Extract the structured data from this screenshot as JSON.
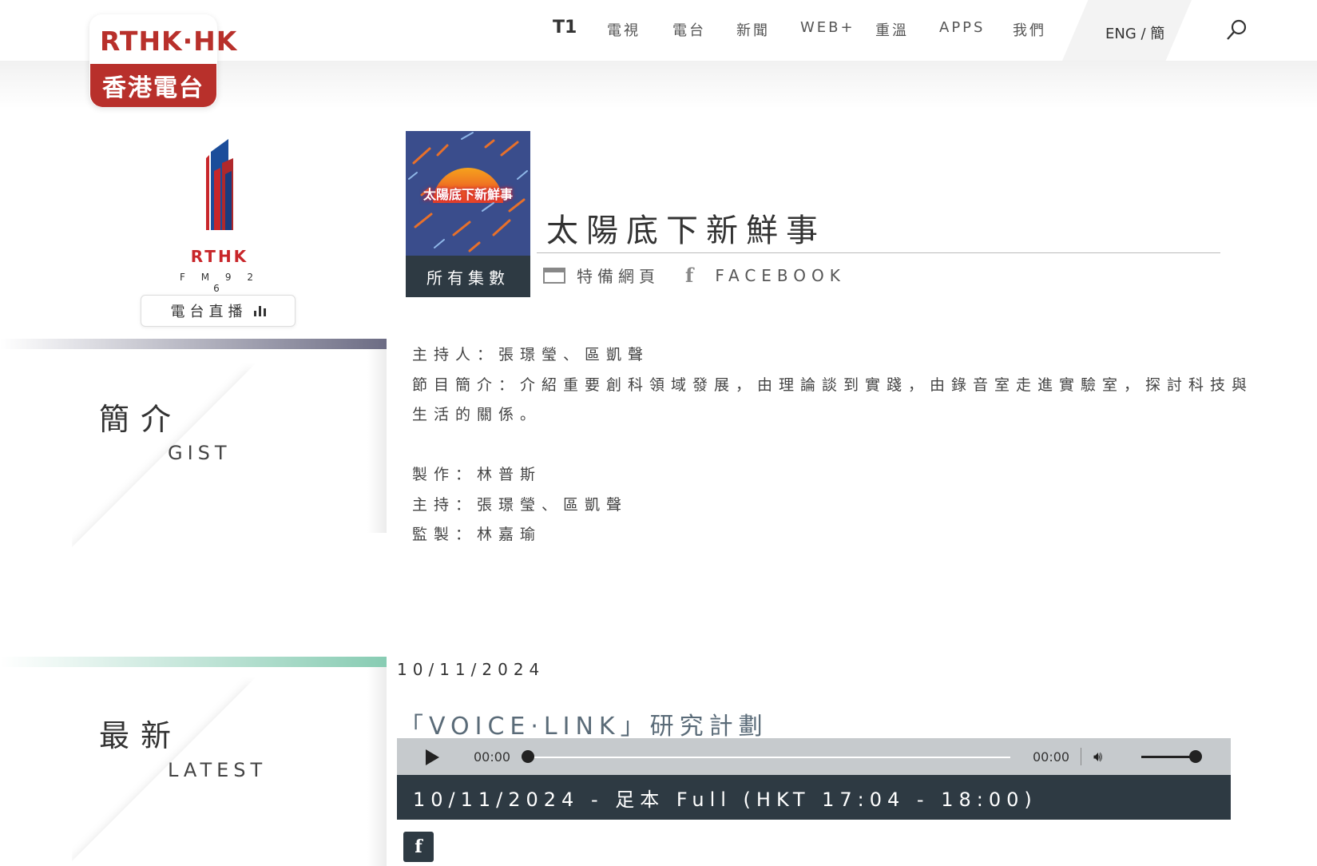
{
  "brand": {
    "logo_top": "RTHK·HK",
    "logo_bottom": "香港電台"
  },
  "nav": {
    "items": [
      "T1",
      "電視",
      "電台",
      "新聞",
      "WEB+",
      "重溫",
      "APPS",
      "我們"
    ],
    "language": "ENG / 簡"
  },
  "station": {
    "name": "RTHK",
    "frequency": "F M 9 2 6",
    "live_label": "電台直播"
  },
  "program": {
    "thumbnail_text": "太陽底下新鮮事",
    "title": "太陽底下新鮮事",
    "all_episodes_label": "所有集數",
    "special_page_label": "特備網頁",
    "facebook_label": "FACEBOOK"
  },
  "gist": {
    "title_zh": "簡介",
    "title_en": "GIST",
    "host_line": "主持人：張璟瑩、區凱聲",
    "intro": "節目簡介：介紹重要創科領域發展，由理論談到實踐，由錄音室走進實驗室，探討科技與生活的關係。",
    "producer": "製作：林普斯",
    "hosts": "主持：張璟瑩、區凱聲",
    "supervisor": "監製：林嘉瑜"
  },
  "latest": {
    "title_zh": "最新",
    "title_en": "LATEST",
    "date": "10/11/2024",
    "episode_title": "「VOICE·LINK」研究計劃",
    "player": {
      "current_time": "00:00",
      "duration": "00:00",
      "progress": 0,
      "volume": 1
    },
    "segment_label": "10/11/2024 - 足本 Full (HKT 17:04 - 18:00)"
  },
  "colors": {
    "brand_red": "#b8302b",
    "dark_slate": "#2e3a43",
    "gist_accent": "#6c6c84",
    "latest_accent": "#88ccb3"
  }
}
